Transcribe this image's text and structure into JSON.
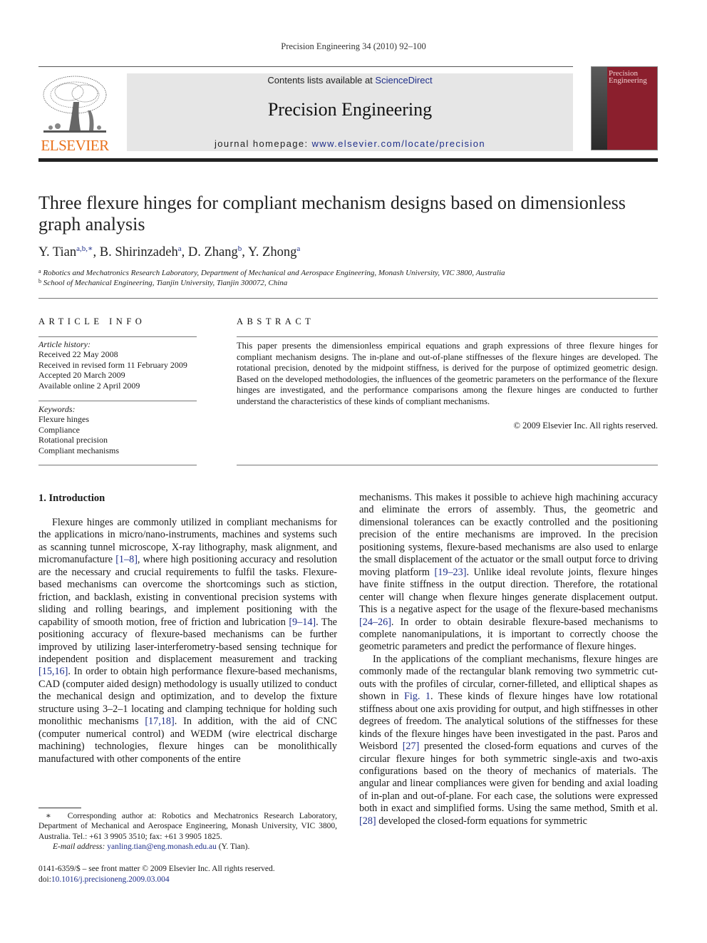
{
  "running_head": "Precision Engineering 34 (2010) 92–100",
  "header": {
    "publisher_wordmark": "ELSEVIER",
    "contents_prefix": "Contents lists available at ",
    "contents_link": "ScienceDirect",
    "journal_name": "Precision Engineering",
    "homepage_prefix": "journal homepage: ",
    "homepage_link": "www.elsevier.com/locate/precision",
    "cover_title_line1": "Precision",
    "cover_title_line2": "Engineering",
    "cover_color": "#8b1f2d",
    "logo_color": "#e9711c"
  },
  "article": {
    "title": "Three flexure hinges for compliant mechanism designs based on dimensionless graph analysis",
    "authors": [
      {
        "name": "Y. Tian",
        "sup": "a,b,∗",
        "sep": ", "
      },
      {
        "name": "B. Shirinzadeh",
        "sup": "a",
        "sep": ", "
      },
      {
        "name": "D. Zhang",
        "sup": "b",
        "sep": ", "
      },
      {
        "name": "Y. Zhong",
        "sup": "a",
        "sep": ""
      }
    ],
    "affiliations": [
      {
        "mark": "a",
        "text": "Robotics and Mechatronics Research Laboratory, Department of Mechanical and Aerospace Engineering, Monash University, VIC 3800, Australia"
      },
      {
        "mark": "b",
        "text": "School of Mechanical Engineering, Tianjin University, Tianjin 300072, China"
      }
    ]
  },
  "article_info": {
    "heading": "ARTICLE INFO",
    "history_label": "Article history:",
    "history": [
      "Received 22 May 2008",
      "Received in revised form 11 February 2009",
      "Accepted 20 March 2009",
      "Available online 2 April 2009"
    ],
    "keywords_label": "Keywords:",
    "keywords": [
      "Flexure hinges",
      "Compliance",
      "Rotational precision",
      "Compliant mechanisms"
    ]
  },
  "abstract": {
    "heading": "ABSTRACT",
    "text": "This paper presents the dimensionless empirical equations and graph expressions of three flexure hinges for compliant mechanism designs. The in-plane and out-of-plane stiffnesses of the flexure hinges are developed. The rotational precision, denoted by the midpoint stiffness, is derived for the purpose of optimized geometric design. Based on the developed methodologies, the influences of the geometric parameters on the performance of the flexure hinges are investigated, and the performance comparisons among the flexure hinges are conducted to further understand the characteristics of these kinds of compliant mechanisms.",
    "copyright": "© 2009 Elsevier Inc. All rights reserved."
  },
  "body": {
    "section_heading": "1.  Introduction",
    "left_p1": [
      "Flexure hinges are commonly utilized in compliant mechanisms for the applications in micro/nano-instruments, machines and systems such as scanning tunnel microscope, X-ray lithography, mask alignment, and micromanufacture ",
      "[1–8]",
      ", where high positioning accuracy and resolution are the necessary and crucial requirements to fulfil the tasks. Flexure-based mechanisms can overcome the shortcomings such as stiction, friction, and backlash, existing in conventional precision systems with sliding and rolling bearings, and implement positioning with the capability of smooth motion, free of friction and lubrication ",
      "[9–14]",
      ". The positioning accuracy of flexure-based mechanisms can be further improved by utilizing laser-interferometry-based sensing technique for independent position and displacement measurement and tracking ",
      "[15,16]",
      ". In order to obtain high performance flexure-based mechanisms, CAD (computer aided design) methodology is usually utilized to conduct the mechanical design and optimization, and to develop the fixture structure using 3–2–1 locating and clamping technique for holding such monolithic mechanisms ",
      "[17,18]",
      ". In addition, with the aid of CNC (computer numerical control) and WEDM (wire electrical discharge machining) technologies, flexure hinges can be monolithically manufactured with other components of the entire"
    ],
    "right_p1": [
      "mechanisms. This makes it possible to achieve high machining accuracy and eliminate the errors of assembly. Thus, the geometric and dimensional tolerances can be exactly controlled and the positioning precision of the entire mechanisms are improved. In the precision positioning systems, flexure-based mechanisms are also used to enlarge the small displacement of the actuator or the small output force to driving moving platform ",
      "[19–23]",
      ". Unlike ideal revolute joints, flexure hinges have finite stiffness in the output direction. Therefore, the rotational center will change when flexure hinges generate displacement output. This is a negative aspect for the usage of the flexure-based mechanisms ",
      "[24–26]",
      ". In order to obtain desirable flexure-based mechanisms to complete nanomanipulations, it is important to correctly choose the geometric parameters and predict the performance of flexure hinges."
    ],
    "right_p2": [
      "In the applications of the compliant mechanisms, flexure hinges are commonly made of the rectangular blank removing two symmetric cut-outs with the profiles of circular, corner-filleted, and elliptical shapes as shown in ",
      "Fig. 1",
      ". These kinds of flexure hinges have low rotational stiffness about one axis providing for output, and high stiffnesses in other degrees of freedom. The analytical solutions of the stiffnesses for these kinds of the flexure hinges have been investigated in the past. Paros and Weisbord ",
      "[27]",
      " presented the closed-form equations and curves of the circular flexure hinges for both symmetric single-axis and two-axis configurations based on the theory of mechanics of materials. The angular and linear compliances were given for bending and axial loading of in-plan and out-of-plane. For each case, the solutions were expressed both in exact and simplified forms. Using the same method, Smith et al. ",
      "[28]",
      " developed the closed-form equations for symmetric"
    ]
  },
  "footnote": {
    "star": "∗",
    "text": "Corresponding author at: Robotics and Mechatronics Research Laboratory, Department of Mechanical and Aerospace Engineering, Monash University, VIC 3800, Australia. Tel.: +61 3 9905 3510; fax: +61 3 9905 1825.",
    "email_label": "E-mail address:",
    "email": "yanling.tian@eng.monash.edu.au",
    "email_suffix": " (Y. Tian)."
  },
  "issn_line": "0141-6359/$ – see front matter © 2009 Elsevier Inc. All rights reserved.",
  "doi_prefix": "doi:",
  "doi": "10.1016/j.precisioneng.2009.03.004"
}
